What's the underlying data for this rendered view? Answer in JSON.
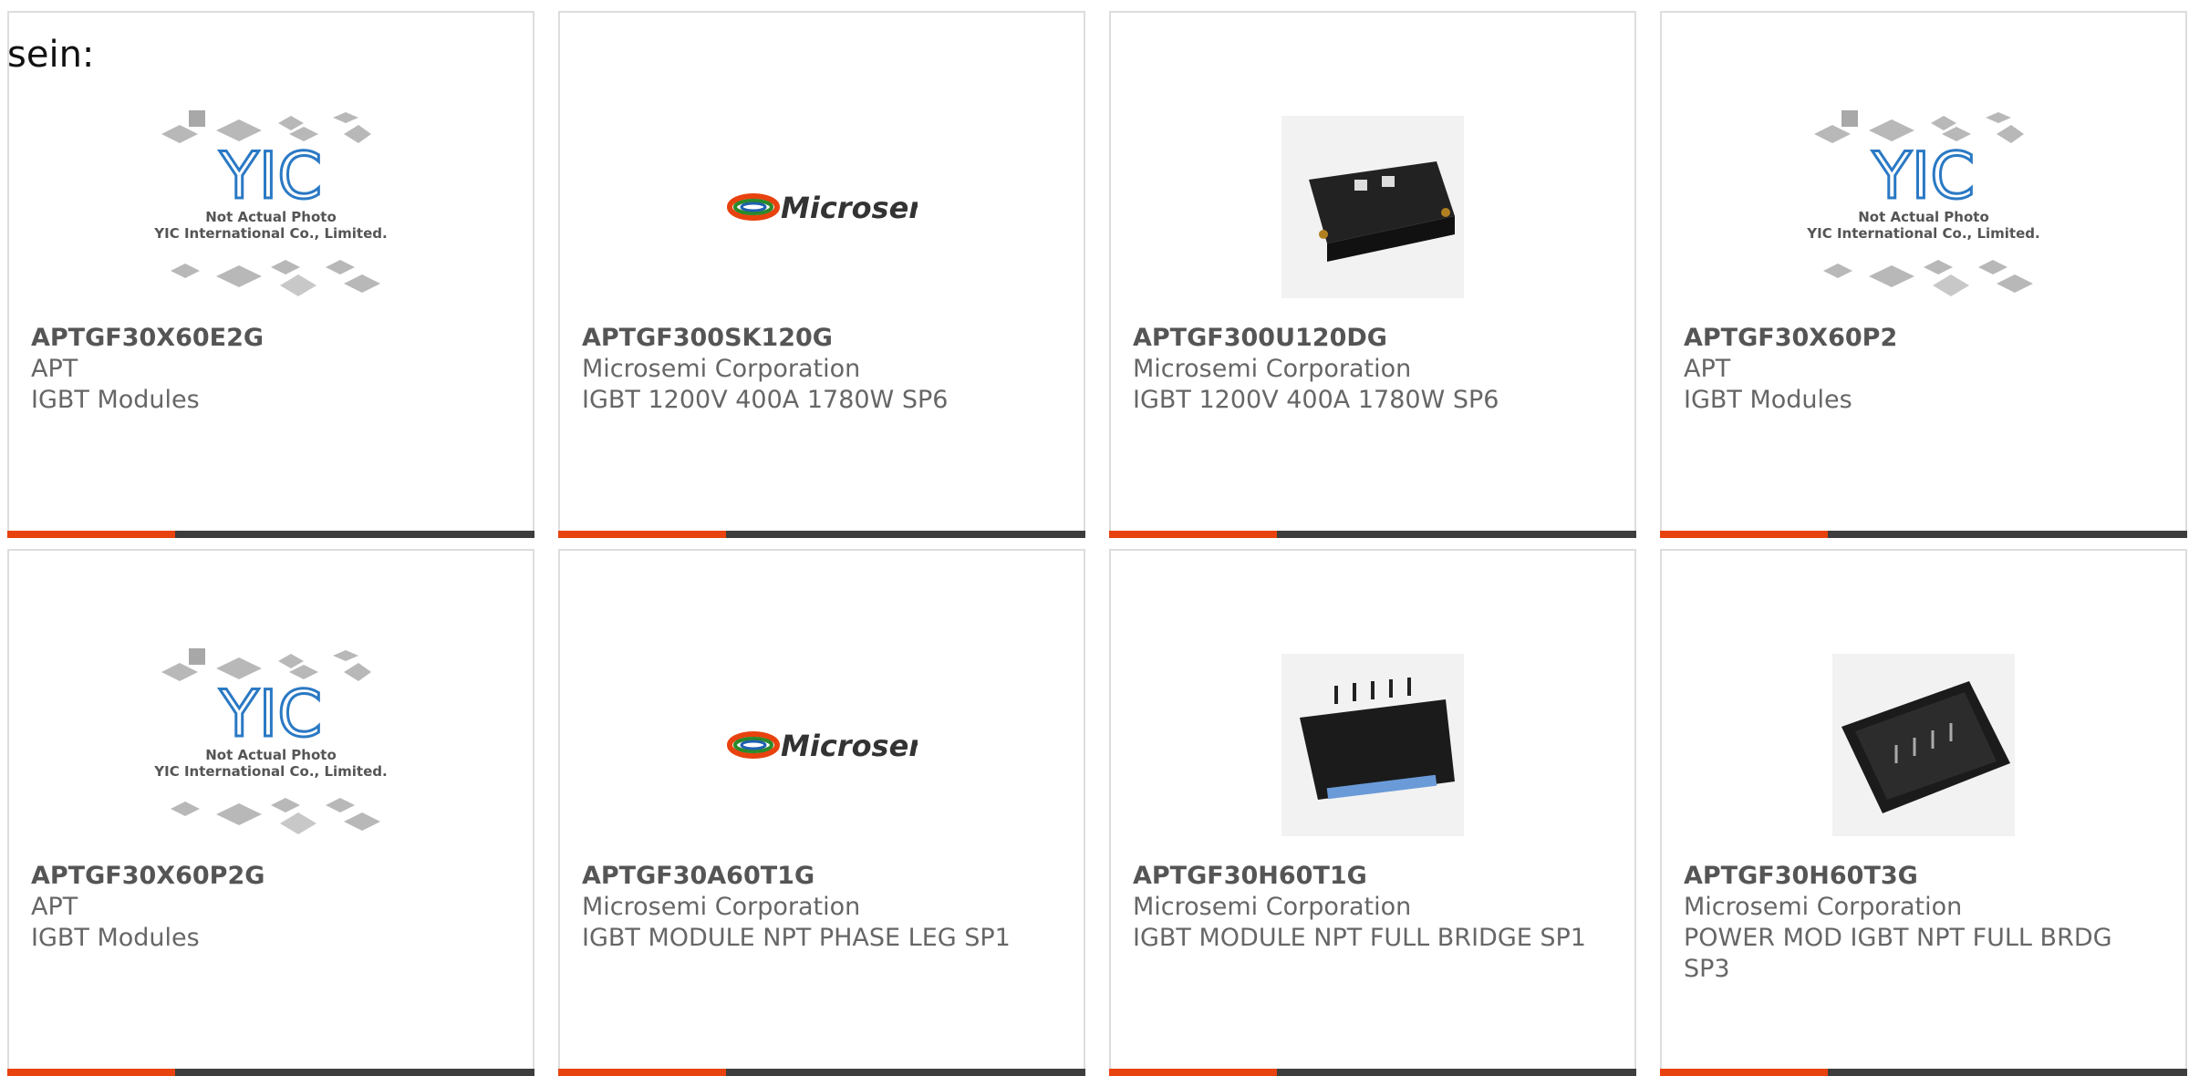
{
  "intro_text": "sein:",
  "colors": {
    "accent": "#e8420e",
    "bar": "#3d3d3d",
    "border": "#dddddd"
  },
  "placeholder": {
    "line1": "Not Actual Photo",
    "line2": "YIC International Co., Limited.",
    "logo": "YIC"
  },
  "microsemi_logo": "Microsemi",
  "products": [
    {
      "pn": "APTGF30X60E2G",
      "maker": "APT",
      "desc": "IGBT Modules",
      "image": "yic-placeholder"
    },
    {
      "pn": "APTGF300SK120G",
      "maker": "Microsemi Corporation",
      "desc": "IGBT 1200V 400A 1780W SP6",
      "image": "microsemi-logo"
    },
    {
      "pn": "APTGF300U120DG",
      "maker": "Microsemi Corporation",
      "desc": "IGBT 1200V 400A 1780W SP6",
      "image": "module-photo"
    },
    {
      "pn": "APTGF30X60P2",
      "maker": "APT",
      "desc": "IGBT Modules",
      "image": "yic-placeholder"
    },
    {
      "pn": "APTGF30X60P2G",
      "maker": "APT",
      "desc": "IGBT Modules",
      "image": "yic-placeholder"
    },
    {
      "pn": "APTGF30A60T1G",
      "maker": "Microsemi Corporation",
      "desc": "IGBT MODULE NPT PHASE LEG SP1",
      "image": "microsemi-logo"
    },
    {
      "pn": "APTGF30H60T1G",
      "maker": "Microsemi Corporation",
      "desc": "IGBT MODULE NPT FULL BRIDGE SP1",
      "image": "sp1-photo"
    },
    {
      "pn": "APTGF30H60T3G",
      "maker": "Microsemi Corporation",
      "desc": "POWER MOD IGBT NPT FULL BRDG SP3",
      "image": "sp3-photo"
    }
  ]
}
